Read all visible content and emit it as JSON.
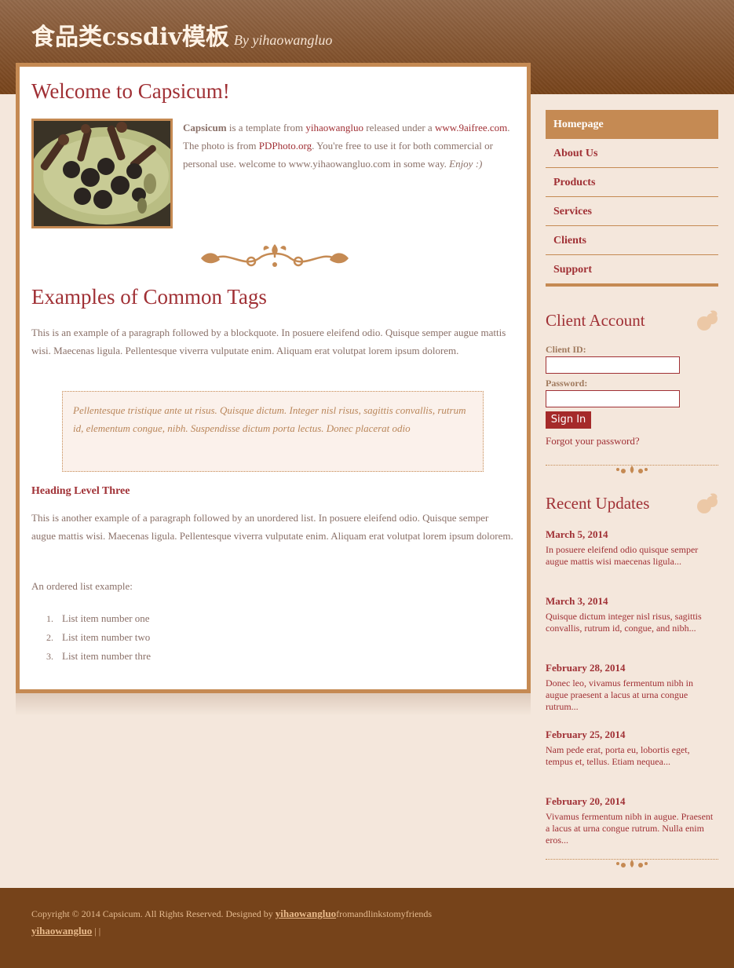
{
  "header": {
    "title": "食品类cssdiv模板",
    "byline": "By yihaowangluo"
  },
  "main": {
    "welcome_title": "Welcome to Capsicum!",
    "intro": {
      "brand": "Capsicum",
      "t1": " is a template from ",
      "link1": "yihaowangluo",
      "t2": " released under a ",
      "link2": "www.9aifree.com",
      "t3": ". The photo is from ",
      "link3": "PDPhoto.org",
      "t4": ". You're free to use it for both commercial or personal use. welcome to www.yihaowangluo.com in some way. ",
      "enjoy": "Enjoy :)"
    },
    "examples_title": "Examples of Common Tags",
    "para1": "This is an example of a paragraph followed by a blockquote. In posuere eleifend odio. Quisque semper augue mattis wisi. Maecenas ligula. Pellentesque viverra vulputate enim. Aliquam erat volutpat lorem ipsum dolorem.",
    "blockquote": "Pellentesque tristique ante ut risus. Quisque dictum. Integer nisl risus, sagittis convallis, rutrum id, elementum congue, nibh. Suspendisse dictum porta lectus. Donec placerat odio",
    "heading3": "Heading Level Three",
    "para2": "This is another example of a paragraph followed by an unordered list. In posuere eleifend odio. Quisque semper augue mattis wisi. Maecenas ligula. Pellentesque viverra vulputate enim. Aliquam erat volutpat lorem ipsum dolorem.",
    "ordered_intro": "An ordered list example:",
    "ordered_list": [
      {
        "num": "1.",
        "label": "List item number one"
      },
      {
        "num": "2.",
        "label": "List item number two"
      },
      {
        "num": "3.",
        "label": "List item number thre"
      }
    ]
  },
  "nav": {
    "items": [
      {
        "label": "Homepage",
        "active": true
      },
      {
        "label": "About Us"
      },
      {
        "label": "Products"
      },
      {
        "label": "Services"
      },
      {
        "label": "Clients"
      },
      {
        "label": "Support"
      }
    ]
  },
  "account": {
    "title": "Client Account",
    "client_id_label": "Client ID:",
    "client_id_value": "",
    "password_label": "Password:",
    "password_value": "",
    "sign_in": "Sign In",
    "forgot": "Forgot your password?"
  },
  "updates": {
    "title": "Recent Updates",
    "items": [
      {
        "date": "March 5, 2014",
        "text": "In posuere eleifend odio quisque semper augue mattis wisi maecenas ligula..."
      },
      {
        "date": "March 3, 2014",
        "text": "Quisque dictum integer nisl risus, sagittis convallis, rutrum id, congue, and nibh..."
      },
      {
        "date": "February 28, 2014",
        "text": "Donec leo, vivamus fermentum nibh in augue praesent a lacus at urna congue rutrum..."
      },
      {
        "date": "February 25, 2014",
        "text": "Nam pede erat, porta eu, lobortis eget, tempus et, tellus. Etiam nequea..."
      },
      {
        "date": "February 20, 2014",
        "text": "Vivamus fermentum nibh in augue. Praesent a lacus at urna congue rutrum. Nulla enim eros..."
      }
    ]
  },
  "footer": {
    "copyright": "Copyright © 2014 Capsicum. All Rights Reserved. Designed by ",
    "designer_link": "yihaowangluo",
    "after_link": "fromandlinkstomyfriends",
    "link2": "yihaowangluo",
    "tail": " | |"
  },
  "colors": {
    "accent": "#c58a53",
    "heading": "#a03035",
    "footer_bg": "#76431a",
    "page_bg": "#f4e7dc"
  }
}
